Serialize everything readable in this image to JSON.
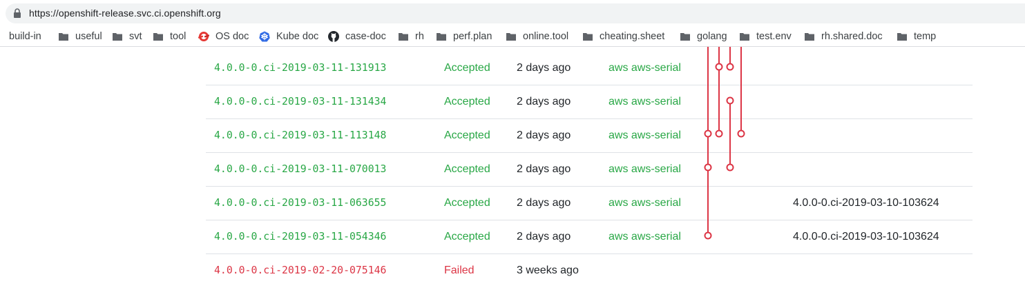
{
  "browser": {
    "url": "https://openshift-release.svc.ci.openshift.org"
  },
  "bookmarks": [
    {
      "label": "build-in",
      "icon": "folder-icon"
    },
    {
      "label": "useful",
      "icon": "folder-icon"
    },
    {
      "label": "svt",
      "icon": "folder-icon"
    },
    {
      "label": "tool",
      "icon": "folder-icon"
    },
    {
      "label": "OS doc",
      "icon": "openshift-logo-icon"
    },
    {
      "label": "Kube doc",
      "icon": "kubernetes-logo-icon"
    },
    {
      "label": "case-doc",
      "icon": "github-logo-icon"
    },
    {
      "label": "rh",
      "icon": "folder-icon"
    },
    {
      "label": "perf.plan",
      "icon": "folder-icon"
    },
    {
      "label": "online.tool",
      "icon": "folder-icon"
    },
    {
      "label": "cheating.sheet",
      "icon": "folder-icon"
    },
    {
      "label": "golang",
      "icon": "folder-icon"
    },
    {
      "label": "test.env",
      "icon": "folder-icon"
    },
    {
      "label": "rh.shared.doc",
      "icon": "folder-icon"
    },
    {
      "label": "temp",
      "icon": "folder-icon"
    }
  ],
  "colors": {
    "accepted": "#28a745",
    "failed": "#dc3545",
    "graph": "#dc3545"
  },
  "releases": [
    {
      "name": "4.0.0-0.ci-2019-03-11-131913",
      "status": "Accepted",
      "age": "2 days ago",
      "tests": "aws aws-serial",
      "upgrade_from": ""
    },
    {
      "name": "4.0.0-0.ci-2019-03-11-131434",
      "status": "Accepted",
      "age": "2 days ago",
      "tests": "aws aws-serial",
      "upgrade_from": ""
    },
    {
      "name": "4.0.0-0.ci-2019-03-11-113148",
      "status": "Accepted",
      "age": "2 days ago",
      "tests": "aws aws-serial",
      "upgrade_from": ""
    },
    {
      "name": "4.0.0-0.ci-2019-03-11-070013",
      "status": "Accepted",
      "age": "2 days ago",
      "tests": "aws aws-serial",
      "upgrade_from": ""
    },
    {
      "name": "4.0.0-0.ci-2019-03-11-063655",
      "status": "Accepted",
      "age": "2 days ago",
      "tests": "aws aws-serial",
      "upgrade_from": "4.0.0-0.ci-2019-03-10-103624"
    },
    {
      "name": "4.0.0-0.ci-2019-03-11-054346",
      "status": "Accepted",
      "age": "2 days ago",
      "tests": "aws aws-serial",
      "upgrade_from": "4.0.0-0.ci-2019-03-10-103624"
    },
    {
      "name": "4.0.0-0.ci-2019-02-20-075146",
      "status": "Failed",
      "age": "3 weeks ago",
      "tests": "",
      "upgrade_from": ""
    }
  ]
}
